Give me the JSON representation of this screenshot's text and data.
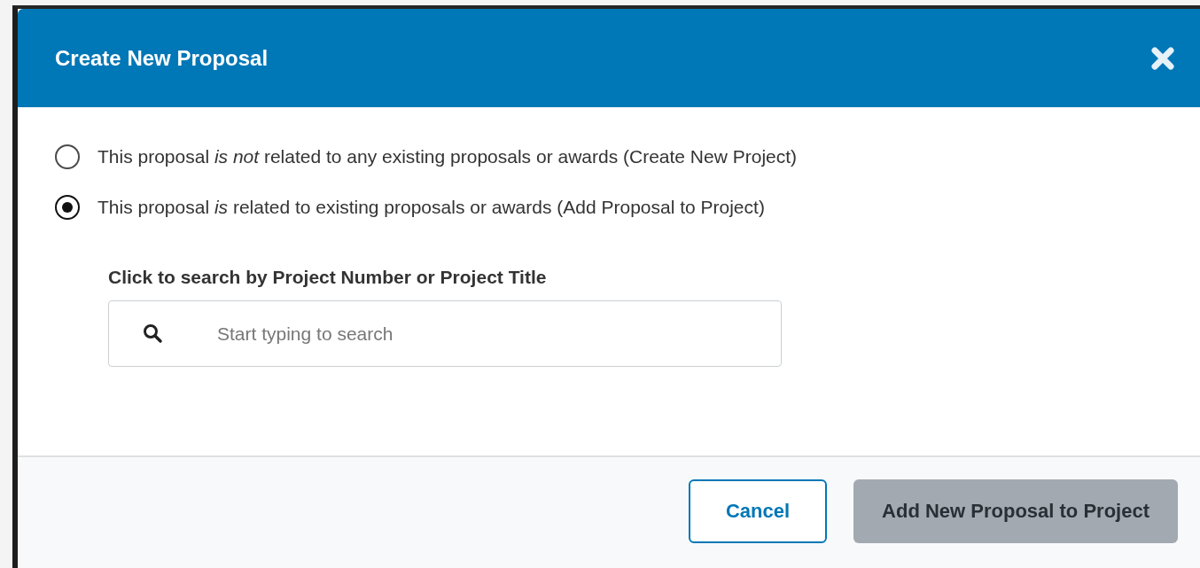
{
  "dialog": {
    "title": "Create New Proposal",
    "options": [
      {
        "label": "This proposal *is not* related to any existing proposals or awards (Create New Project)",
        "selected": false
      },
      {
        "label": "This proposal *is* related to existing proposals or awards (Add Proposal to Project)",
        "selected": true
      }
    ],
    "search": {
      "label": "Click to search by Project Number or Project Title",
      "placeholder": "Start typing to search"
    },
    "buttons": [
      {
        "label": "Cancel",
        "kind": "secondary",
        "disabled": false
      },
      {
        "label": "Add New Proposal to Project",
        "kind": "primary",
        "disabled": true
      }
    ]
  }
}
